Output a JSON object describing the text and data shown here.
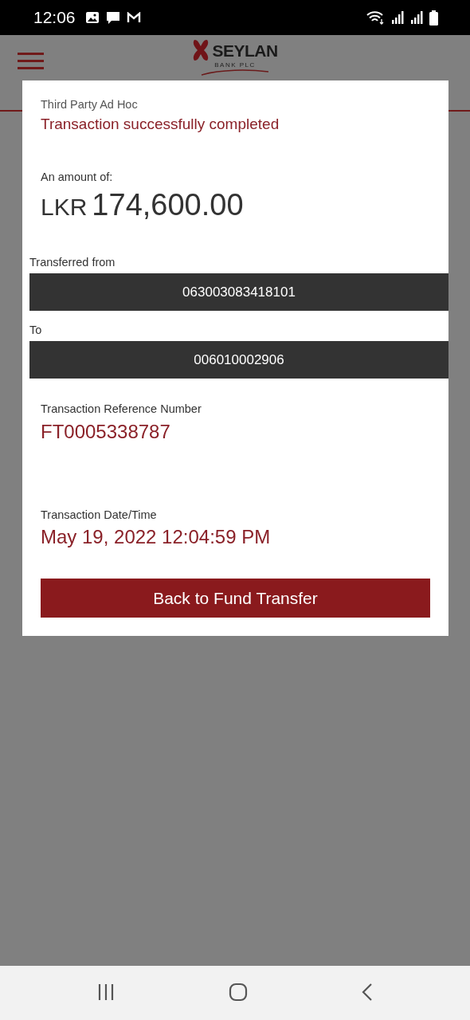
{
  "status_bar": {
    "time": "12:06"
  },
  "header": {
    "logo_name": "SEYLAN",
    "logo_subtitle": "BANK PLC"
  },
  "dialog": {
    "category": "Third Party Ad Hoc",
    "status": "Transaction successfully completed",
    "amount_label": "An amount of:",
    "currency": "LKR",
    "amount": "174,600.00",
    "from_label": "Transferred from",
    "from_account": "063003083418101",
    "to_label": "To",
    "to_account": "006010002906",
    "reference_label": "Transaction Reference Number",
    "reference": "FT0005338787",
    "datetime_label": "Transaction Date/Time",
    "datetime": "May 19, 2022 12:04:59 PM",
    "button": "Back to Fund Transfer"
  }
}
